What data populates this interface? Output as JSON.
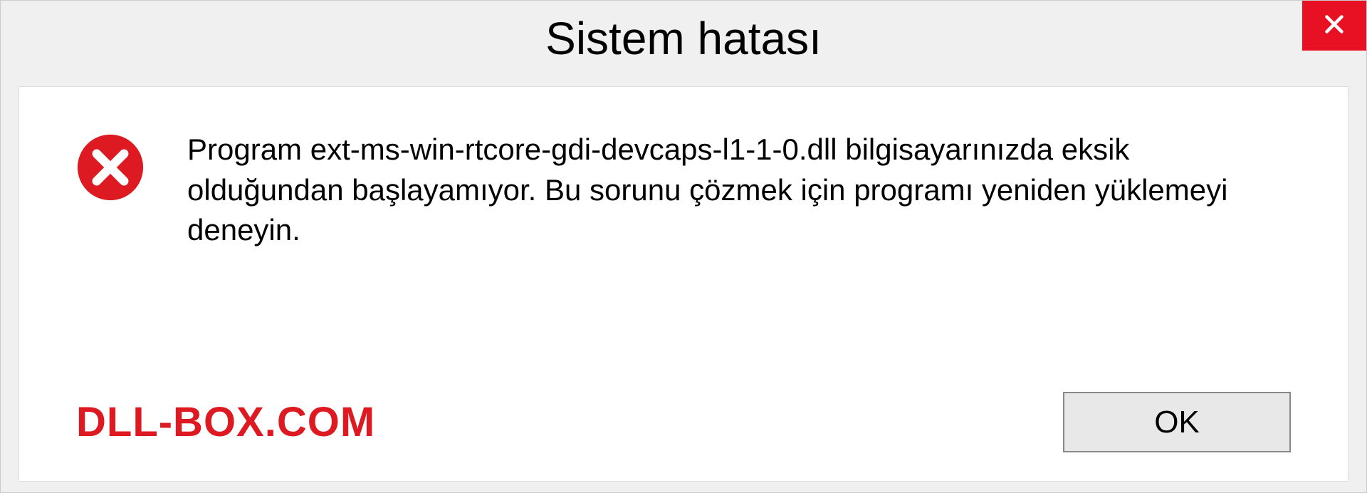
{
  "dialog": {
    "title": "Sistem hatası",
    "message": "Program ext-ms-win-rtcore-gdi-devcaps-l1-1-0.dll bilgisayarınızda eksik olduğundan başlayamıyor. Bu sorunu çözmek için programı yeniden yüklemeyi deneyin.",
    "ok_label": "OK",
    "watermark": "DLL-BOX.COM"
  }
}
